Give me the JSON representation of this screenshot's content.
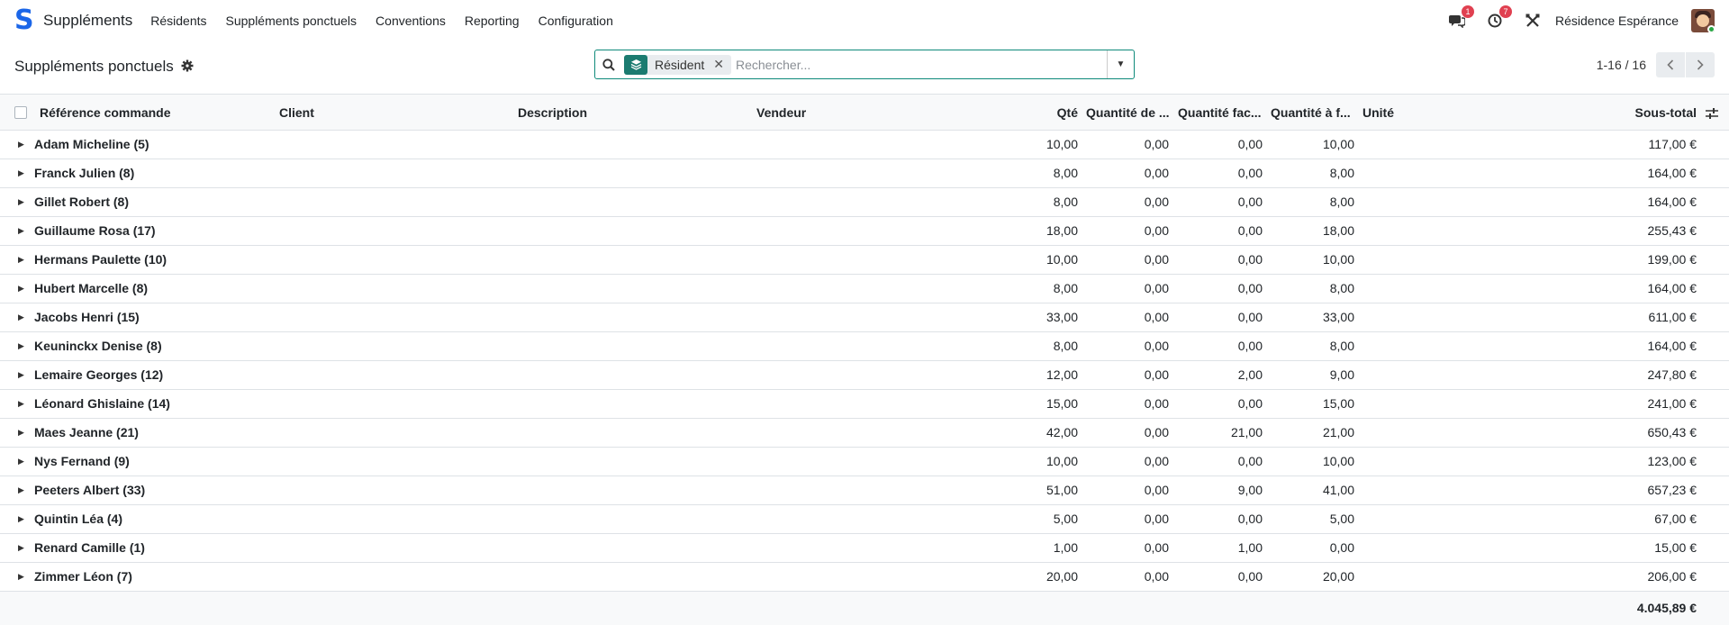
{
  "navbar": {
    "logo": "S",
    "app_title": "Suppléments",
    "menu": [
      "Résidents",
      "Suppléments ponctuels",
      "Conventions",
      "Reporting",
      "Configuration"
    ],
    "messages_badge": "1",
    "activities_badge": "7",
    "company": "Résidence Espérance"
  },
  "control": {
    "breadcrumb": "Suppléments ponctuels",
    "search": {
      "facet": "Résident",
      "placeholder": "Rechercher..."
    },
    "pager": "1-16 / 16"
  },
  "table": {
    "headers": {
      "reference": "Référence commande",
      "client": "Client",
      "description": "Description",
      "seller": "Vendeur",
      "qty": "Qté",
      "qty_delivered": "Quantité de ...",
      "qty_invoiced": "Quantité fac...",
      "qty_to_invoice": "Quantité à f...",
      "unit": "Unité",
      "subtotal": "Sous-total"
    },
    "groups": [
      {
        "name": "Adam Micheline (5)",
        "qty": "10,00",
        "q1": "0,00",
        "q2": "0,00",
        "q3": "10,00",
        "subtotal": "117,00 €"
      },
      {
        "name": "Franck Julien (8)",
        "qty": "8,00",
        "q1": "0,00",
        "q2": "0,00",
        "q3": "8,00",
        "subtotal": "164,00 €"
      },
      {
        "name": "Gillet Robert (8)",
        "qty": "8,00",
        "q1": "0,00",
        "q2": "0,00",
        "q3": "8,00",
        "subtotal": "164,00 €"
      },
      {
        "name": "Guillaume Rosa (17)",
        "qty": "18,00",
        "q1": "0,00",
        "q2": "0,00",
        "q3": "18,00",
        "subtotal": "255,43 €"
      },
      {
        "name": "Hermans Paulette (10)",
        "qty": "10,00",
        "q1": "0,00",
        "q2": "0,00",
        "q3": "10,00",
        "subtotal": "199,00 €"
      },
      {
        "name": "Hubert Marcelle (8)",
        "qty": "8,00",
        "q1": "0,00",
        "q2": "0,00",
        "q3": "8,00",
        "subtotal": "164,00 €"
      },
      {
        "name": "Jacobs Henri (15)",
        "qty": "33,00",
        "q1": "0,00",
        "q2": "0,00",
        "q3": "33,00",
        "subtotal": "611,00 €"
      },
      {
        "name": "Keuninckx Denise (8)",
        "qty": "8,00",
        "q1": "0,00",
        "q2": "0,00",
        "q3": "8,00",
        "subtotal": "164,00 €"
      },
      {
        "name": "Lemaire Georges (12)",
        "qty": "12,00",
        "q1": "0,00",
        "q2": "2,00",
        "q3": "9,00",
        "subtotal": "247,80 €"
      },
      {
        "name": "Léonard Ghislaine (14)",
        "qty": "15,00",
        "q1": "0,00",
        "q2": "0,00",
        "q3": "15,00",
        "subtotal": "241,00 €"
      },
      {
        "name": "Maes Jeanne (21)",
        "qty": "42,00",
        "q1": "0,00",
        "q2": "21,00",
        "q3": "21,00",
        "subtotal": "650,43 €"
      },
      {
        "name": "Nys Fernand (9)",
        "qty": "10,00",
        "q1": "0,00",
        "q2": "0,00",
        "q3": "10,00",
        "subtotal": "123,00 €"
      },
      {
        "name": "Peeters Albert (33)",
        "qty": "51,00",
        "q1": "0,00",
        "q2": "9,00",
        "q3": "41,00",
        "subtotal": "657,23 €"
      },
      {
        "name": "Quintin Léa (4)",
        "qty": "5,00",
        "q1": "0,00",
        "q2": "0,00",
        "q3": "5,00",
        "subtotal": "67,00 €"
      },
      {
        "name": "Renard Camille (1)",
        "qty": "1,00",
        "q1": "0,00",
        "q2": "1,00",
        "q3": "0,00",
        "subtotal": "15,00 €"
      },
      {
        "name": "Zimmer Léon (7)",
        "qty": "20,00",
        "q1": "0,00",
        "q2": "0,00",
        "q3": "20,00",
        "subtotal": "206,00 €"
      }
    ],
    "total": "4.045,89 €"
  }
}
